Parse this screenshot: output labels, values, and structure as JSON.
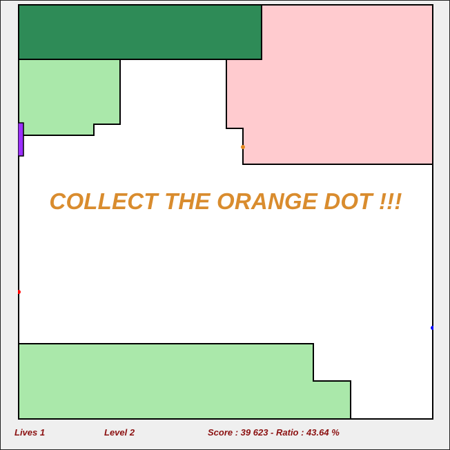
{
  "game": {
    "message": "COLLECT THE ORANGE DOT !!!",
    "lives": "Lives 1",
    "level": "Level 2",
    "score": "Score : 39 623 - Ratio : 43.64 %"
  },
  "colors": {
    "board_background": "#ffffff",
    "dark_green": "#2e8b57",
    "light_green": "#aae8aa",
    "pink": "#ffcbcf",
    "outline": "#000000",
    "message": "#d98c2e",
    "status_text": "#8b1010",
    "player": "#9b30ff",
    "orange_dot": "#e6891f",
    "red_enemy": "#ff0000",
    "blue_enemy": "#0000ff"
  }
}
